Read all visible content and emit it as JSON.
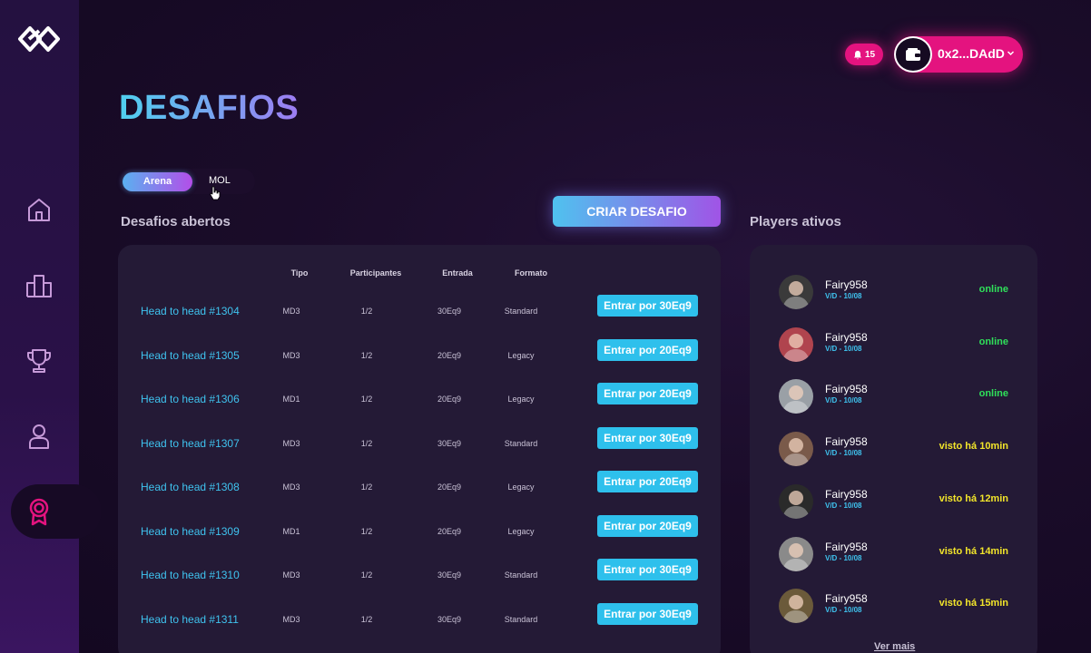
{
  "header": {
    "notifications_count": "15",
    "wallet_address": "0x2...DAdD"
  },
  "page": {
    "title": "DESAFIOS"
  },
  "tabs": [
    {
      "label": "Arena",
      "active": true
    },
    {
      "label": "MOL",
      "active": false
    }
  ],
  "challenges": {
    "section_title": "Desafios abertos",
    "create_button_label": "CRIAR DESAFIO",
    "columns": [
      "Tipo",
      "Participantes",
      "Entrada",
      "Formato"
    ],
    "rows": [
      {
        "name": "Head to head #1304",
        "tipo": "MD3",
        "participantes": "1/2",
        "entrada": "30Eq9",
        "formato": "Standard",
        "button": "Entrar por 30Eq9"
      },
      {
        "name": "Head to head #1305",
        "tipo": "MD3",
        "participantes": "1/2",
        "entrada": "20Eq9",
        "formato": "Legacy",
        "button": "Entrar por 20Eq9"
      },
      {
        "name": "Head to head #1306",
        "tipo": "MD1",
        "participantes": "1/2",
        "entrada": "20Eq9",
        "formato": "Legacy",
        "button": "Entrar por 20Eq9"
      },
      {
        "name": "Head to head #1307",
        "tipo": "MD3",
        "participantes": "1/2",
        "entrada": "30Eq9",
        "formato": "Standard",
        "button": "Entrar por 30Eq9"
      },
      {
        "name": "Head to head #1308",
        "tipo": "MD3",
        "participantes": "1/2",
        "entrada": "20Eq9",
        "formato": "Legacy",
        "button": "Entrar por 20Eq9"
      },
      {
        "name": "Head to head #1309",
        "tipo": "MD1",
        "participantes": "1/2",
        "entrada": "20Eq9",
        "formato": "Legacy",
        "button": "Entrar por 20Eq9"
      },
      {
        "name": "Head to head #1310",
        "tipo": "MD3",
        "participantes": "1/2",
        "entrada": "30Eq9",
        "formato": "Standard",
        "button": "Entrar por 30Eq9"
      },
      {
        "name": "Head to head #1311",
        "tipo": "MD3",
        "participantes": "1/2",
        "entrada": "30Eq9",
        "formato": "Standard",
        "button": "Entrar por 30Eq9"
      }
    ]
  },
  "players": {
    "section_title": "Players ativos",
    "list": [
      {
        "name": "Fairy958",
        "record": "V/D - 10/08",
        "status": "online",
        "status_color": "#2fe05a",
        "avatar_color": "#3a3a3a"
      },
      {
        "name": "Fairy958",
        "record": "V/D - 10/08",
        "status": "online",
        "status_color": "#2fe05a",
        "avatar_color": "#b0444e"
      },
      {
        "name": "Fairy958",
        "record": "V/D - 10/08",
        "status": "online",
        "status_color": "#2fe05a",
        "avatar_color": "#9aa0a6"
      },
      {
        "name": "Fairy958",
        "record": "V/D - 10/08",
        "status": "visto há 10min",
        "status_color": "#f2e52a",
        "avatar_color": "#7a5a4a"
      },
      {
        "name": "Fairy958",
        "record": "V/D - 10/08",
        "status": "visto há 12min",
        "status_color": "#f2e52a",
        "avatar_color": "#2a2a2a"
      },
      {
        "name": "Fairy958",
        "record": "V/D - 10/08",
        "status": "visto há 14min",
        "status_color": "#f2e52a",
        "avatar_color": "#8a8a8a"
      },
      {
        "name": "Fairy958",
        "record": "V/D - 10/08",
        "status": "visto há 15min",
        "status_color": "#f2e52a",
        "avatar_color": "#6b5a3a"
      }
    ],
    "see_more_label": "Ver mais"
  },
  "sidebar": {
    "items": [
      {
        "icon": "home-icon"
      },
      {
        "icon": "ranking-icon"
      },
      {
        "icon": "trophy-icon"
      },
      {
        "icon": "profile-icon"
      },
      {
        "icon": "badge-icon",
        "active": true
      }
    ]
  },
  "colors": {
    "accent_pink": "#e4137f",
    "accent_cyan": "#2ec0ec",
    "online": "#2fe05a",
    "away": "#f2e52a"
  }
}
